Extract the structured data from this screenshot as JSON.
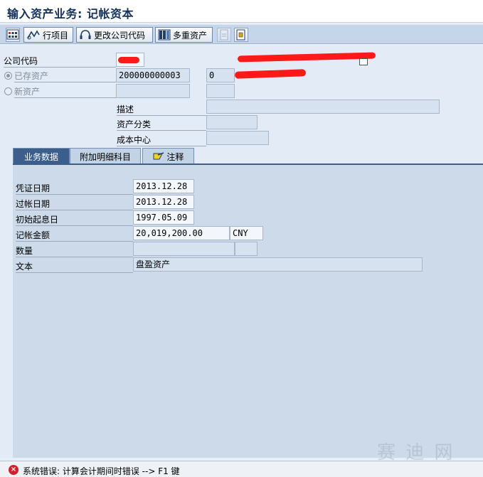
{
  "title": "输入资产业务: 记帐资本",
  "toolbar": {
    "line_items": "行项目",
    "change_company": "更改公司代码",
    "multiple_assets": "多重资产"
  },
  "header": {
    "company_code_label": "公司代码",
    "existing_asset_label": "已存资产",
    "existing_asset_number": "200000000003",
    "existing_asset_sub": "0",
    "new_asset_label": "新资产",
    "description_label": "描述",
    "asset_class_label": "资产分类",
    "cost_center_label": "成本中心"
  },
  "tabs": [
    "业务数据",
    "附加明细科目",
    "注释"
  ],
  "transaction": {
    "doc_date_label": "凭证日期",
    "doc_date": "2013.12.28",
    "posting_date_label": "过帐日期",
    "posting_date": "2013.12.28",
    "capitalization_date_label": "初始起息日",
    "capitalization_date": "1997.05.09",
    "amount_label": "记帐金额",
    "amount": "20,019,200.00",
    "currency": "CNY",
    "quantity_label": "数量",
    "text_label": "文本",
    "text_value": "盘盈资产"
  },
  "status": {
    "message": "系统错误: 计算会计期间时错误 --> F1 键",
    "type": "error"
  },
  "watermark": "赛 迪 网",
  "colors": {
    "active_tab": "#3b5e8c",
    "error": "#d3202a",
    "redaction": "#ff1a1a"
  }
}
